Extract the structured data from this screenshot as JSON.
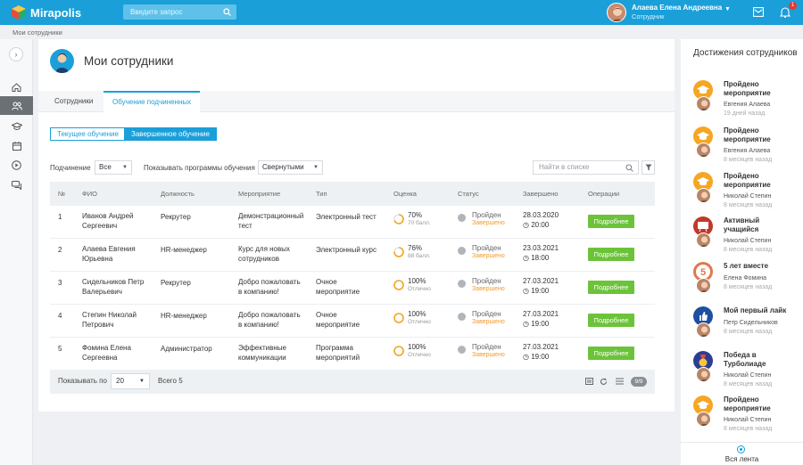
{
  "app": {
    "brand": "Mirapolis"
  },
  "topbar": {
    "search_placeholder": "Введите запрос",
    "user_name": "Алаева Елена Андреевна",
    "user_role": "Сотрудник",
    "notifications_count": "1"
  },
  "breadcrumb": "Мои сотрудники",
  "page": {
    "title": "Мои сотрудники",
    "tabs": [
      {
        "label": "Сотрудники"
      },
      {
        "label": "Обучение подчиненных"
      }
    ],
    "segments": [
      {
        "label": "Текущее обучение"
      },
      {
        "label": "Завершенное обучение"
      }
    ],
    "filters": {
      "subordination_label": "Подчинение",
      "subordination_value": "Все",
      "programs_label": "Показывать программы обучения",
      "programs_value": "Свернутыми",
      "search_placeholder": "Найти в списке"
    }
  },
  "table": {
    "columns": [
      "№",
      "ФИО",
      "Должность",
      "Мероприятие",
      "Тип",
      "Оценка",
      "Статус",
      "Завершено",
      "Операции"
    ],
    "rows": [
      {
        "num": "1",
        "name": [
          "Иванов Андрей",
          "Сергеевич"
        ],
        "position": "Рекрутер",
        "event": [
          "Демонстрационный",
          "тест"
        ],
        "type": [
          "Электронный тест"
        ],
        "score": "70%",
        "score_sub": "70 балл.",
        "score_pct": 70,
        "status": "Пройден",
        "status_sub": "Завершено",
        "date": "28.03.2020",
        "time": "20:00",
        "action": "Подробнее"
      },
      {
        "num": "2",
        "name": [
          "Алаева Евгения",
          "Юрьевна"
        ],
        "position": "HR-менеджер",
        "event": [
          "Курс для новых",
          "сотрудников"
        ],
        "type": [
          "Электронный курс"
        ],
        "score": "76%",
        "score_sub": "88 балл.",
        "score_pct": 76,
        "status": "Пройден",
        "status_sub": "Завершено",
        "date": "23.03.2021",
        "time": "18:00",
        "action": "Подробнее"
      },
      {
        "num": "3",
        "name": [
          "Сидельников Петр",
          "Валерьевич"
        ],
        "position": "Рекрутер",
        "event": [
          "Добро пожаловать",
          "в компанию!"
        ],
        "type": [
          "Очное",
          "мероприятие"
        ],
        "score": "100%",
        "score_sub": "Отлично",
        "score_pct": 100,
        "status": "Пройден",
        "status_sub": "Завершено",
        "date": "27.03.2021",
        "time": "19:00",
        "action": "Подробнее"
      },
      {
        "num": "4",
        "name": [
          "Степин Николай",
          "Петрович"
        ],
        "position": "HR-менеджер",
        "event": [
          "Добро пожаловать",
          "в компанию!"
        ],
        "type": [
          "Очное",
          "мероприятие"
        ],
        "score": "100%",
        "score_sub": "Отлично",
        "score_pct": 100,
        "status": "Пройден",
        "status_sub": "Завершено",
        "date": "27.03.2021",
        "time": "19:00",
        "action": "Подробнее"
      },
      {
        "num": "5",
        "name": [
          "Фомина Елена",
          "Сергеевна"
        ],
        "position": "Администратор",
        "event": [
          "Эффективные",
          "коммуникации"
        ],
        "type": [
          "Программа",
          "мероприятий"
        ],
        "score": "100%",
        "score_sub": "Отлично",
        "score_pct": 100,
        "status": "Пройден",
        "status_sub": "Завершено",
        "date": "27.03.2021",
        "time": "19:00",
        "action": "Подробнее"
      }
    ],
    "footer": {
      "show_by_label": "Показывать по",
      "page_size": "20",
      "total": "Всего 5",
      "counter": "9/9"
    }
  },
  "achievements": {
    "title": "Достижения сотрудников",
    "items": [
      {
        "title": [
          "Пройдено",
          "мероприятие"
        ],
        "name": "Евгения Алаева",
        "time": "19 дней назад",
        "badge": "cap",
        "badge_color": "#f5a623"
      },
      {
        "title": [
          "Пройдено",
          "мероприятие"
        ],
        "name": "Евгения Алаева",
        "time": "8 месяцев назад",
        "badge": "cap",
        "badge_color": "#f5a623"
      },
      {
        "title": [
          "Пройдено",
          "мероприятие"
        ],
        "name": "Николай Степин",
        "time": "8 месяцев назад",
        "badge": "cap",
        "badge_color": "#f5a623"
      },
      {
        "title": [
          "Активный",
          "учащийся"
        ],
        "name": "Николай Степин",
        "time": "8 месяцев назад",
        "badge": "board",
        "badge_color": "#c0392b"
      },
      {
        "title": [
          "5 лет вместе"
        ],
        "name": "Елена Фомина",
        "time": "8 месяцев назад",
        "badge": "five",
        "badge_color": "#e2784a"
      },
      {
        "title": [
          "Мой первый лайк"
        ],
        "name": "Петр Сидельников",
        "time": "8 месяцев назад",
        "badge": "like",
        "badge_color": "#1e4fa0"
      },
      {
        "title": [
          "Победа в",
          "Турболиаде"
        ],
        "name": "Николай Степин",
        "time": "8 месяцев назад",
        "badge": "medal",
        "badge_color": "#2c3e91"
      },
      {
        "title": [
          "Пройдено",
          "мероприятие"
        ],
        "name": "Николай Степин",
        "time": "8 месяцев назад",
        "badge": "cap",
        "badge_color": "#f5a623"
      }
    ],
    "feed_label": "Вся лента"
  },
  "colors": {
    "accent": "#1a9fd9",
    "success": "#6cc33a",
    "warning": "#f29a2e",
    "ring": "#f5a623"
  }
}
